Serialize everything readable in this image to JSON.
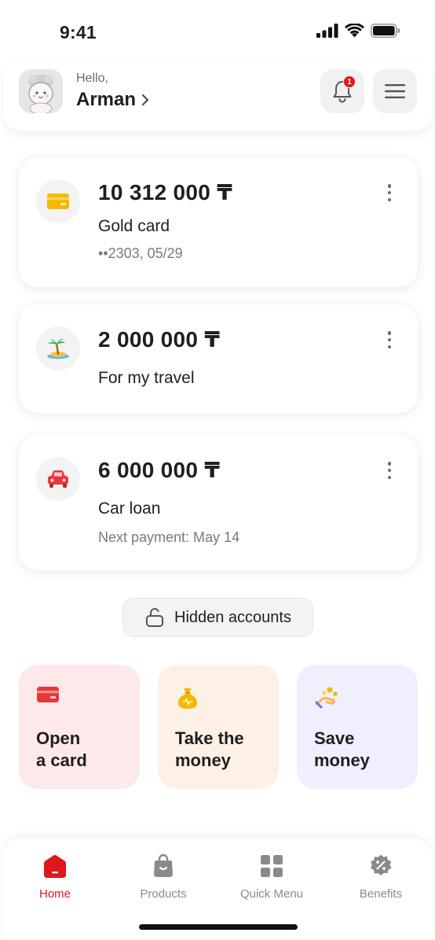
{
  "status": {
    "time": "9:41"
  },
  "header": {
    "greeting": "Hello,",
    "username": "Arman",
    "notifications_count": "1"
  },
  "accounts": [
    {
      "amount": "10 312 000 ₸",
      "name": "Gold card",
      "sub": "••2303, 05/29",
      "icon": "card-icon",
      "accent": "#f5b800"
    },
    {
      "amount": "2 000 000 ₸",
      "name": "For my travel",
      "sub": "",
      "icon": "palm-island-icon",
      "accent": "#2eaa4a"
    },
    {
      "amount": "6 000 000 ₸",
      "name": "Car loan",
      "sub": "Next payment: May 14",
      "icon": "car-icon",
      "accent": "#e6393c"
    }
  ],
  "hidden_accounts": {
    "label": "Hidden accounts"
  },
  "tiles": [
    {
      "label": "Open\na card",
      "bg": "#fde9ea",
      "icon": "card-icon"
    },
    {
      "label": "Take the\nmoney",
      "bg": "#fdf1e6",
      "icon": "money-bag-icon"
    },
    {
      "label": "Save\nmoney",
      "bg": "#efeffe",
      "icon": "hand-coins-icon"
    }
  ],
  "nav": {
    "items": [
      {
        "label": "Home",
        "active": true
      },
      {
        "label": "Products",
        "active": false
      },
      {
        "label": "Quick Menu",
        "active": false
      },
      {
        "label": "Benefits",
        "active": false
      }
    ]
  },
  "colors": {
    "brand": "#e0161b",
    "muted": "#8a8a8a"
  }
}
